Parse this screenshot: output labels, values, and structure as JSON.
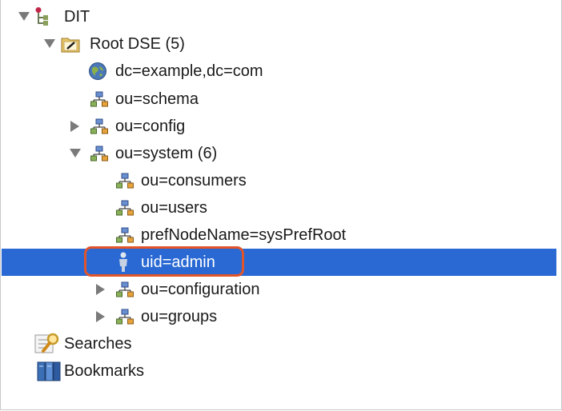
{
  "tree": {
    "dit": {
      "label": "DIT",
      "expanded": true
    },
    "root_dse": {
      "label": "Root DSE (5)",
      "expanded": true
    },
    "dc_example": {
      "label": "dc=example,dc=com"
    },
    "ou_schema": {
      "label": "ou=schema"
    },
    "ou_config": {
      "label": "ou=config",
      "expanded": false
    },
    "ou_system": {
      "label": "ou=system (6)",
      "expanded": true
    },
    "ou_consumers": {
      "label": "ou=consumers"
    },
    "ou_users": {
      "label": "ou=users"
    },
    "pref_node": {
      "label": "prefNodeName=sysPrefRoot"
    },
    "uid_admin": {
      "label": "uid=admin",
      "selected": true
    },
    "ou_configuration": {
      "label": "ou=configuration",
      "expanded": false
    },
    "ou_groups": {
      "label": "ou=groups",
      "expanded": false
    },
    "searches": {
      "label": "Searches"
    },
    "bookmarks": {
      "label": "Bookmarks"
    }
  },
  "colors": {
    "selection": "#2a69d3",
    "highlight": "#e2552a"
  }
}
